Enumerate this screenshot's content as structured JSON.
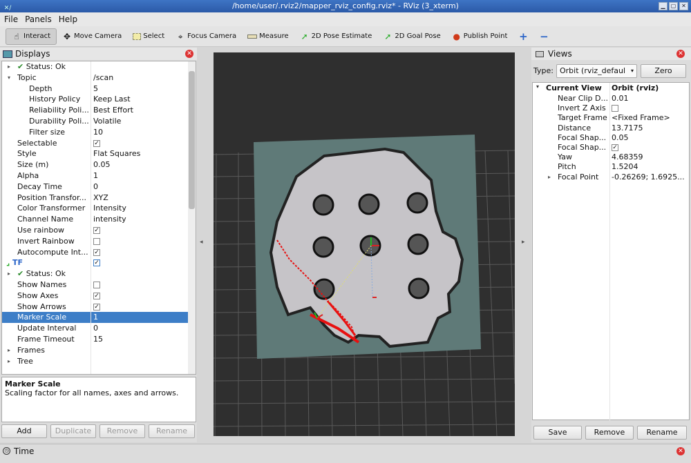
{
  "window": {
    "title": "/home/user/.rviz2/mapper_rviz_config.rviz* - RViz (3_xterm)",
    "corner_icon": "x-icon"
  },
  "menu": [
    "File",
    "Panels",
    "Help"
  ],
  "toolbar": {
    "tools": [
      {
        "label": "Interact",
        "icon": "cursor-icon"
      },
      {
        "label": "Move Camera",
        "icon": "move-icon"
      },
      {
        "label": "Select",
        "icon": "select-box-icon"
      },
      {
        "label": "Focus Camera",
        "icon": "crosshair-icon"
      },
      {
        "label": "Measure",
        "icon": "ruler-icon"
      },
      {
        "label": "2D Pose Estimate",
        "icon": "green-arrow-icon"
      },
      {
        "label": "2D Goal Pose",
        "icon": "green-arrow-icon"
      },
      {
        "label": "Publish Point",
        "icon": "map-pin-icon"
      }
    ],
    "plus_icon": "+",
    "minus_icon": "−"
  },
  "displays": {
    "title": "Displays",
    "rows": [
      {
        "key": "Status: Ok",
        "value": "",
        "indent": 1,
        "arrow": "▸",
        "check": true
      },
      {
        "key": "Topic",
        "value": "/scan",
        "indent": 1,
        "arrow": "▾"
      },
      {
        "key": "Depth",
        "value": "5",
        "indent": 2
      },
      {
        "key": "History Policy",
        "value": "Keep Last",
        "indent": 2
      },
      {
        "key": "Reliability Poli...",
        "value": "Best Effort",
        "indent": 2
      },
      {
        "key": "Durability Poli...",
        "value": "Volatile",
        "indent": 2
      },
      {
        "key": "Filter size",
        "value": "10",
        "indent": 2
      },
      {
        "key": "Selectable",
        "value": "",
        "indent": 1,
        "checkbox": "on"
      },
      {
        "key": "Style",
        "value": "Flat Squares",
        "indent": 1
      },
      {
        "key": "Size (m)",
        "value": "0.05",
        "indent": 1
      },
      {
        "key": "Alpha",
        "value": "1",
        "indent": 1
      },
      {
        "key": "Decay Time",
        "value": "0",
        "indent": 1
      },
      {
        "key": "Position Transfor...",
        "value": "XYZ",
        "indent": 1
      },
      {
        "key": "Color Transformer",
        "value": "Intensity",
        "indent": 1
      },
      {
        "key": "Channel Name",
        "value": "intensity",
        "indent": 1
      },
      {
        "key": "Use rainbow",
        "value": "",
        "indent": 1,
        "checkbox": "on"
      },
      {
        "key": "Invert Rainbow",
        "value": "",
        "indent": 1,
        "checkbox": "off"
      },
      {
        "key": "Autocompute Int...",
        "value": "",
        "indent": 1,
        "checkbox": "on"
      },
      {
        "key": "TF",
        "value": "",
        "indent": 0,
        "checkbox": "on",
        "tf": true
      },
      {
        "key": "Status: Ok",
        "value": "",
        "indent": 1,
        "arrow": "▸",
        "check": true
      },
      {
        "key": "Show Names",
        "value": "",
        "indent": 1,
        "checkbox": "off"
      },
      {
        "key": "Show Axes",
        "value": "",
        "indent": 1,
        "checkbox": "on"
      },
      {
        "key": "Show Arrows",
        "value": "",
        "indent": 1,
        "checkbox": "on"
      },
      {
        "key": "Marker Scale",
        "value": "1",
        "indent": 1,
        "selected": true
      },
      {
        "key": "Update Interval",
        "value": "0",
        "indent": 1
      },
      {
        "key": "Frame Timeout",
        "value": "15",
        "indent": 1
      },
      {
        "key": "Frames",
        "value": "",
        "indent": 1,
        "arrow": "▸"
      },
      {
        "key": "Tree",
        "value": "",
        "indent": 1,
        "arrow": "▸"
      }
    ],
    "help_title": "Marker Scale",
    "help_text": "Scaling factor for all names, axes and arrows.",
    "buttons": {
      "add": "Add",
      "duplicate": "Duplicate",
      "remove": "Remove",
      "rename": "Rename"
    }
  },
  "views": {
    "title": "Views",
    "type_label": "Type:",
    "type_value": "Orbit (rviz_defaul",
    "zero": "Zero",
    "header_key": "Current View",
    "header_value": "Orbit (rviz)",
    "rows": [
      {
        "key": "Near Clip D...",
        "value": "0.01"
      },
      {
        "key": "Invert Z Axis",
        "value": "",
        "checkbox": "off"
      },
      {
        "key": "Target Frame",
        "value": "<Fixed Frame>"
      },
      {
        "key": "Distance",
        "value": "13.7175"
      },
      {
        "key": "Focal Shap...",
        "value": "0.05"
      },
      {
        "key": "Focal Shap...",
        "value": "",
        "checkbox": "on"
      },
      {
        "key": "Yaw",
        "value": "4.68359"
      },
      {
        "key": "Pitch",
        "value": "1.5204"
      },
      {
        "key": "Focal Point",
        "value": "-0.26269; 1.6925...",
        "arrow": "▸"
      }
    ],
    "buttons": {
      "save": "Save",
      "remove": "Remove",
      "rename": "Rename"
    }
  },
  "time": {
    "title": "Time"
  },
  "colors": {
    "accent": "#3d7ec7",
    "viewport": "#2f2f2f",
    "close": "#d33333",
    "laser": "#e81010"
  }
}
